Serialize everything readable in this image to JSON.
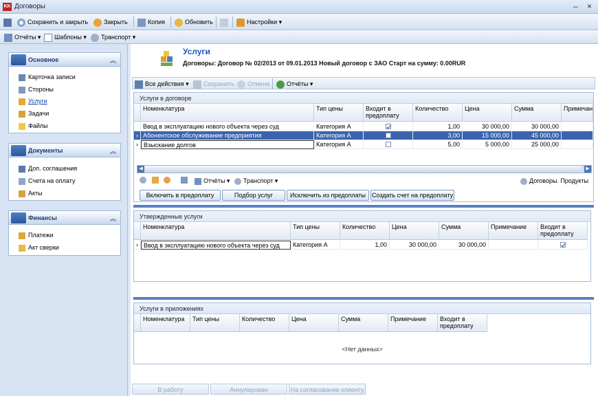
{
  "window": {
    "title": "Договоры",
    "logo": "KK",
    "minimize": "–",
    "close": "×"
  },
  "toolbar_main": {
    "save_close": "Сохранить и закрыть",
    "close": "Закрыть",
    "copy": "Копия",
    "refresh": "Обновить",
    "settings": "Настройки"
  },
  "toolbar_second": {
    "reports": "Отчёты",
    "templates": "Шаблоны",
    "transport": "Транспорт"
  },
  "nav": {
    "groups": [
      {
        "title": "Основное",
        "items": [
          "Карточка записи",
          "Стороны",
          "Услуги",
          "Задачи",
          "Файлы"
        ]
      },
      {
        "title": "Документы",
        "items": [
          "Доп. соглашения",
          "Счета на оплату",
          "Акты"
        ]
      },
      {
        "title": "Финансы",
        "items": [
          "Платежи",
          "Акт сверки"
        ]
      }
    ],
    "active_item": "Услуги"
  },
  "page": {
    "title": "Услуги",
    "subtitle": "Договоры: Договор № 02/2013 от 09.01.2013 Новый договор с ЗАО Старт на сумму: 0.00RUR"
  },
  "actions": {
    "all_actions": "Все действия",
    "save": "Сохранить",
    "cancel": "Отмена",
    "reports": "Отчёты"
  },
  "grid1": {
    "caption": "Услуги в договоре",
    "headers": [
      "Номенклатура",
      "Тип цены",
      "Входит в предоплату",
      "Количество",
      "Цена",
      "Сумма",
      "Примечание"
    ],
    "rows": [
      {
        "name": "Ввод в эксплуатацию нового объекта через суд",
        "type": "Категория А",
        "prepay": true,
        "qty": "1,00",
        "price": "30 000,00",
        "sum": "30 000,00"
      },
      {
        "name": "Абонентское обслуживание предприятия",
        "type": "Категория А",
        "prepay": false,
        "qty": "3,00",
        "price": "15 000,00",
        "sum": "45 000,00"
      },
      {
        "name": "Взыскание долгов",
        "type": "Категория А",
        "prepay": false,
        "qty": "5,00",
        "price": "5 000,00",
        "sum": "25 000,00"
      }
    ],
    "toolbar": {
      "reports": "Отчёты",
      "transport": "Транспорт",
      "right_link": "Договоры. Продукты"
    },
    "buttons": [
      "Включить в предоплату",
      "Подбор услуг",
      "Исключить из предоплаты",
      "Создать счет на предоплату"
    ]
  },
  "grid2": {
    "caption": "Утвержденные услуги",
    "headers": [
      "Номенклатура",
      "Тип цены",
      "Количество",
      "Цена",
      "Сумма",
      "Примечание",
      "Входит в предоплату"
    ],
    "rows": [
      {
        "name": "Ввод в эксплуатацию нового объекта через суд",
        "type": "Категория А",
        "qty": "1,00",
        "price": "30 000,00",
        "sum": "30 000,00",
        "prepay": true
      }
    ]
  },
  "grid3": {
    "caption": "Услуги в приложениях",
    "headers": [
      "Номенклатура",
      "Тип цены",
      "Количество",
      "Цена",
      "Сумма",
      "Примечание",
      "Входит в предоплату"
    ],
    "empty": "<Нет данных>"
  },
  "bottom_buttons": [
    "В работу",
    "Аннулирован",
    "На согласование клиенту"
  ],
  "colors": {
    "accent": "#3b64ae",
    "selection": "#3b64ae",
    "nav_bg": "#d8e4f3"
  }
}
